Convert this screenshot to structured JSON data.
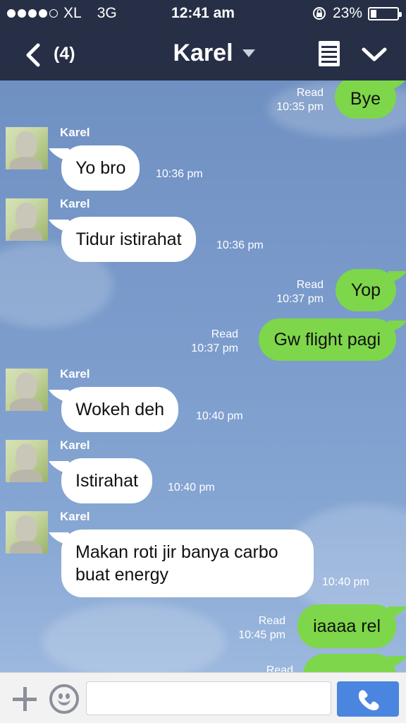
{
  "status_bar": {
    "carrier": "XL",
    "network": "3G",
    "time": "12:41 am",
    "battery_percent": "23%",
    "battery_level": 0.23,
    "signal_bars": 4
  },
  "header": {
    "unread_count": "(4)",
    "contact_name": "Karel",
    "icons": [
      "back-chevron-icon",
      "dropdown-caret-icon",
      "notes-icon",
      "collapse-chevron-icon"
    ]
  },
  "messages": [
    {
      "direction": "out",
      "text": "Bye",
      "read_label": "Read",
      "time": "10:35 pm"
    },
    {
      "direction": "in",
      "sender": "Karel",
      "text": "Yo bro",
      "time": "10:36 pm"
    },
    {
      "direction": "in",
      "sender": "Karel",
      "text": "Tidur istirahat",
      "time": "10:36 pm"
    },
    {
      "direction": "out",
      "text": "Yop",
      "read_label": "Read",
      "time": "10:37 pm"
    },
    {
      "direction": "out",
      "text": "Gw flight pagi",
      "read_label": "Read",
      "time": "10:37 pm"
    },
    {
      "direction": "in",
      "sender": "Karel",
      "text": "Wokeh deh",
      "time": "10:40 pm"
    },
    {
      "direction": "in",
      "sender": "Karel",
      "text": "Istirahat",
      "time": "10:40 pm"
    },
    {
      "direction": "in",
      "sender": "Karel",
      "text_line1": "Makan roti jir banya carbo",
      "text_line2": "buat energy",
      "time": "10:40 pm"
    },
    {
      "direction": "out",
      "text": "iaaaa rel",
      "read_label": "Read",
      "time": "10:45 pm"
    },
    {
      "direction": "out",
      "text": "",
      "read_label": "Read",
      "time": ""
    }
  ],
  "input_bar": {
    "placeholder": "",
    "icons": [
      "plus-icon",
      "emoji-icon",
      "phone-icon"
    ]
  },
  "colors": {
    "header_bg": "#262f45",
    "chat_bg": "#7a99c7",
    "outgoing_bubble": "#7ed64a",
    "incoming_bubble": "#ffffff",
    "call_button": "#4a86e0"
  }
}
